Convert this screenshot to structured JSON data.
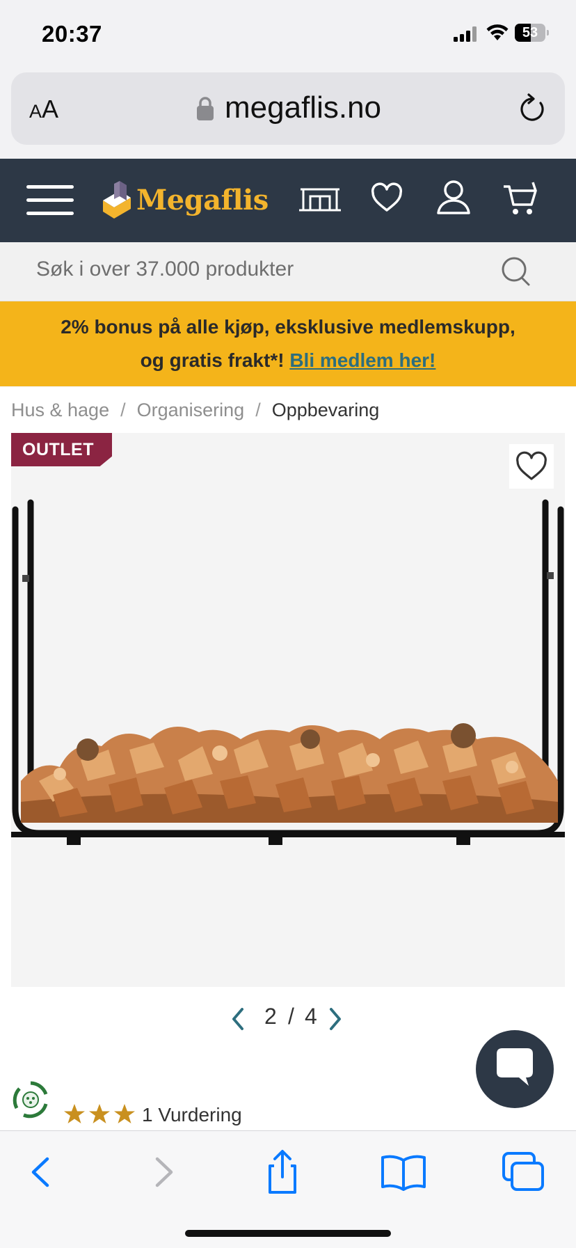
{
  "status": {
    "time": "20:37",
    "battery": "53"
  },
  "browser": {
    "text_size_small": "A",
    "text_size_large": "A",
    "url": "megaflis.no"
  },
  "header": {
    "brand": "Megaflis"
  },
  "search": {
    "placeholder": "Søk i over 37.000 produkter"
  },
  "promo": {
    "line1": "2% bonus på alle kjøp, eksklusive medlemskupp,",
    "line2": "og gratis frakt*!",
    "link": "Bli medlem her!"
  },
  "breadcrumb": {
    "items": [
      "Hus & hage",
      "Organisering",
      "Oppbevaring"
    ],
    "separator": "/"
  },
  "product": {
    "badge": "OUTLET",
    "rating_stars": 3,
    "reviews": "1 Vurdering"
  },
  "gallery": {
    "current": "2",
    "separator": "/",
    "total": "4"
  },
  "colors": {
    "header": "#2d3846",
    "brand": "#f3b42d",
    "promo": "#f4b41a",
    "badge": "#8b2442",
    "link": "#2d6e7e",
    "ios_blue": "#0a7aff",
    "star": "#c9901f"
  }
}
